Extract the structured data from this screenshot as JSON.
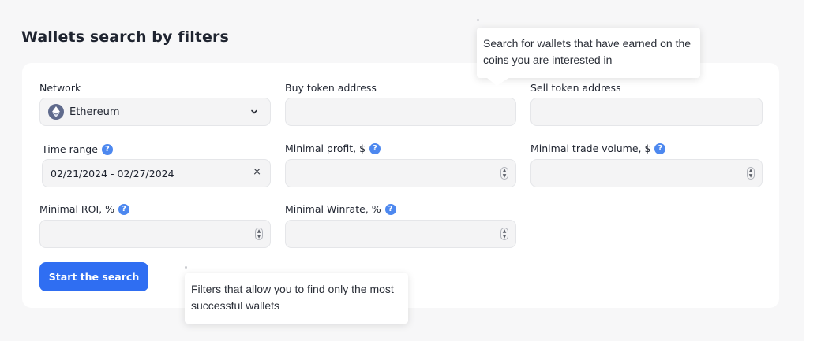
{
  "page": {
    "title": "Wallets search by filters"
  },
  "filters": {
    "network": {
      "label": "Network",
      "value": "Ethereum",
      "icon": "ethereum-icon"
    },
    "buy_token": {
      "label": "Buy token address",
      "value": "",
      "placeholder": ""
    },
    "sell_token": {
      "label": "Sell token address",
      "value": "",
      "placeholder": ""
    },
    "time_range": {
      "label": "Time range",
      "value": "02/21/2024 - 02/27/2024",
      "clear_glyph": "×"
    },
    "minimal_profit": {
      "label": "Minimal profit, $",
      "value": ""
    },
    "minimal_trade_volume": {
      "label": "Minimal trade volume, $",
      "value": ""
    },
    "minimal_roi": {
      "label": "Minimal ROI, %",
      "value": ""
    },
    "minimal_winrate": {
      "label": "Minimal Winrate, %",
      "value": ""
    },
    "help_glyph": "?"
  },
  "actions": {
    "start_label": "Start the search"
  },
  "tooltips": {
    "token_address": "Search for wallets that have earned on the coins you are interested in",
    "filters": "Filters that allow you to find only the most successful wallets"
  },
  "colors": {
    "accent": "#2f6ef2",
    "help_icon": "#4d88ef",
    "page_background": "#f7f7f8",
    "card_background": "#ffffff",
    "input_background": "#f4f4f5"
  }
}
